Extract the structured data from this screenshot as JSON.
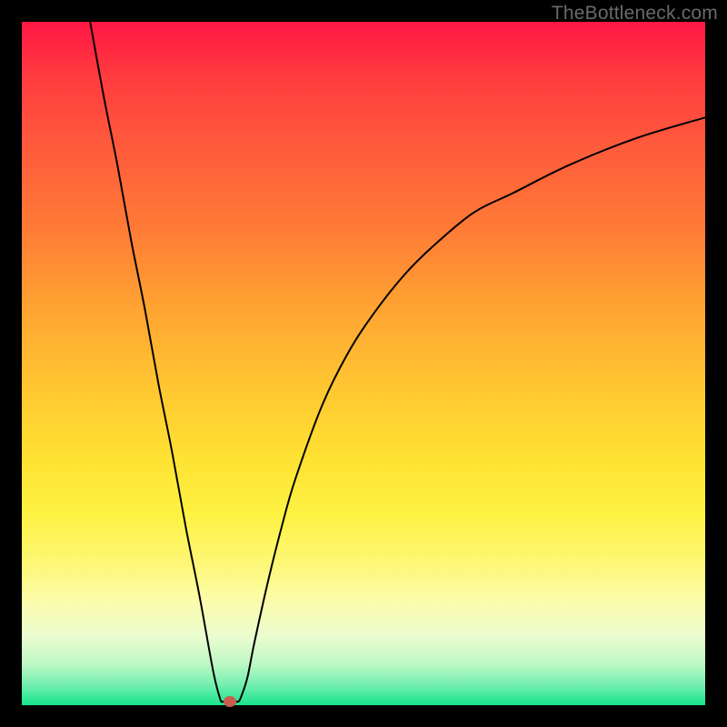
{
  "watermark": "TheBottleneck.com",
  "colors": {
    "frame": "#000000",
    "curve": "#000000",
    "marker": "#c95b50"
  },
  "chart_data": {
    "type": "line",
    "title": "",
    "xlabel": "",
    "ylabel": "",
    "xlim": [
      0,
      100
    ],
    "ylim": [
      0,
      100
    ],
    "grid": false,
    "series": [
      {
        "name": "bottleneck-curve",
        "x": [
          10,
          12,
          14,
          16,
          18,
          20,
          22,
          24,
          26,
          28,
          29,
          30,
          31,
          32,
          33,
          34,
          36,
          38,
          40,
          44,
          48,
          52,
          56,
          60,
          66,
          72,
          80,
          90,
          100
        ],
        "y": [
          100,
          89,
          79,
          68,
          58,
          47,
          37,
          26,
          16,
          5,
          1,
          0.5,
          0.5,
          1,
          4,
          9,
          18,
          26,
          33,
          44,
          52,
          58,
          63,
          67,
          72,
          75,
          79,
          83,
          86
        ]
      }
    ],
    "marker": {
      "x": 30.5,
      "y": 0.5,
      "color": "#c95b50"
    },
    "plateau_segment": {
      "x0": 29.3,
      "x1": 31.6,
      "y": 0.5
    }
  }
}
